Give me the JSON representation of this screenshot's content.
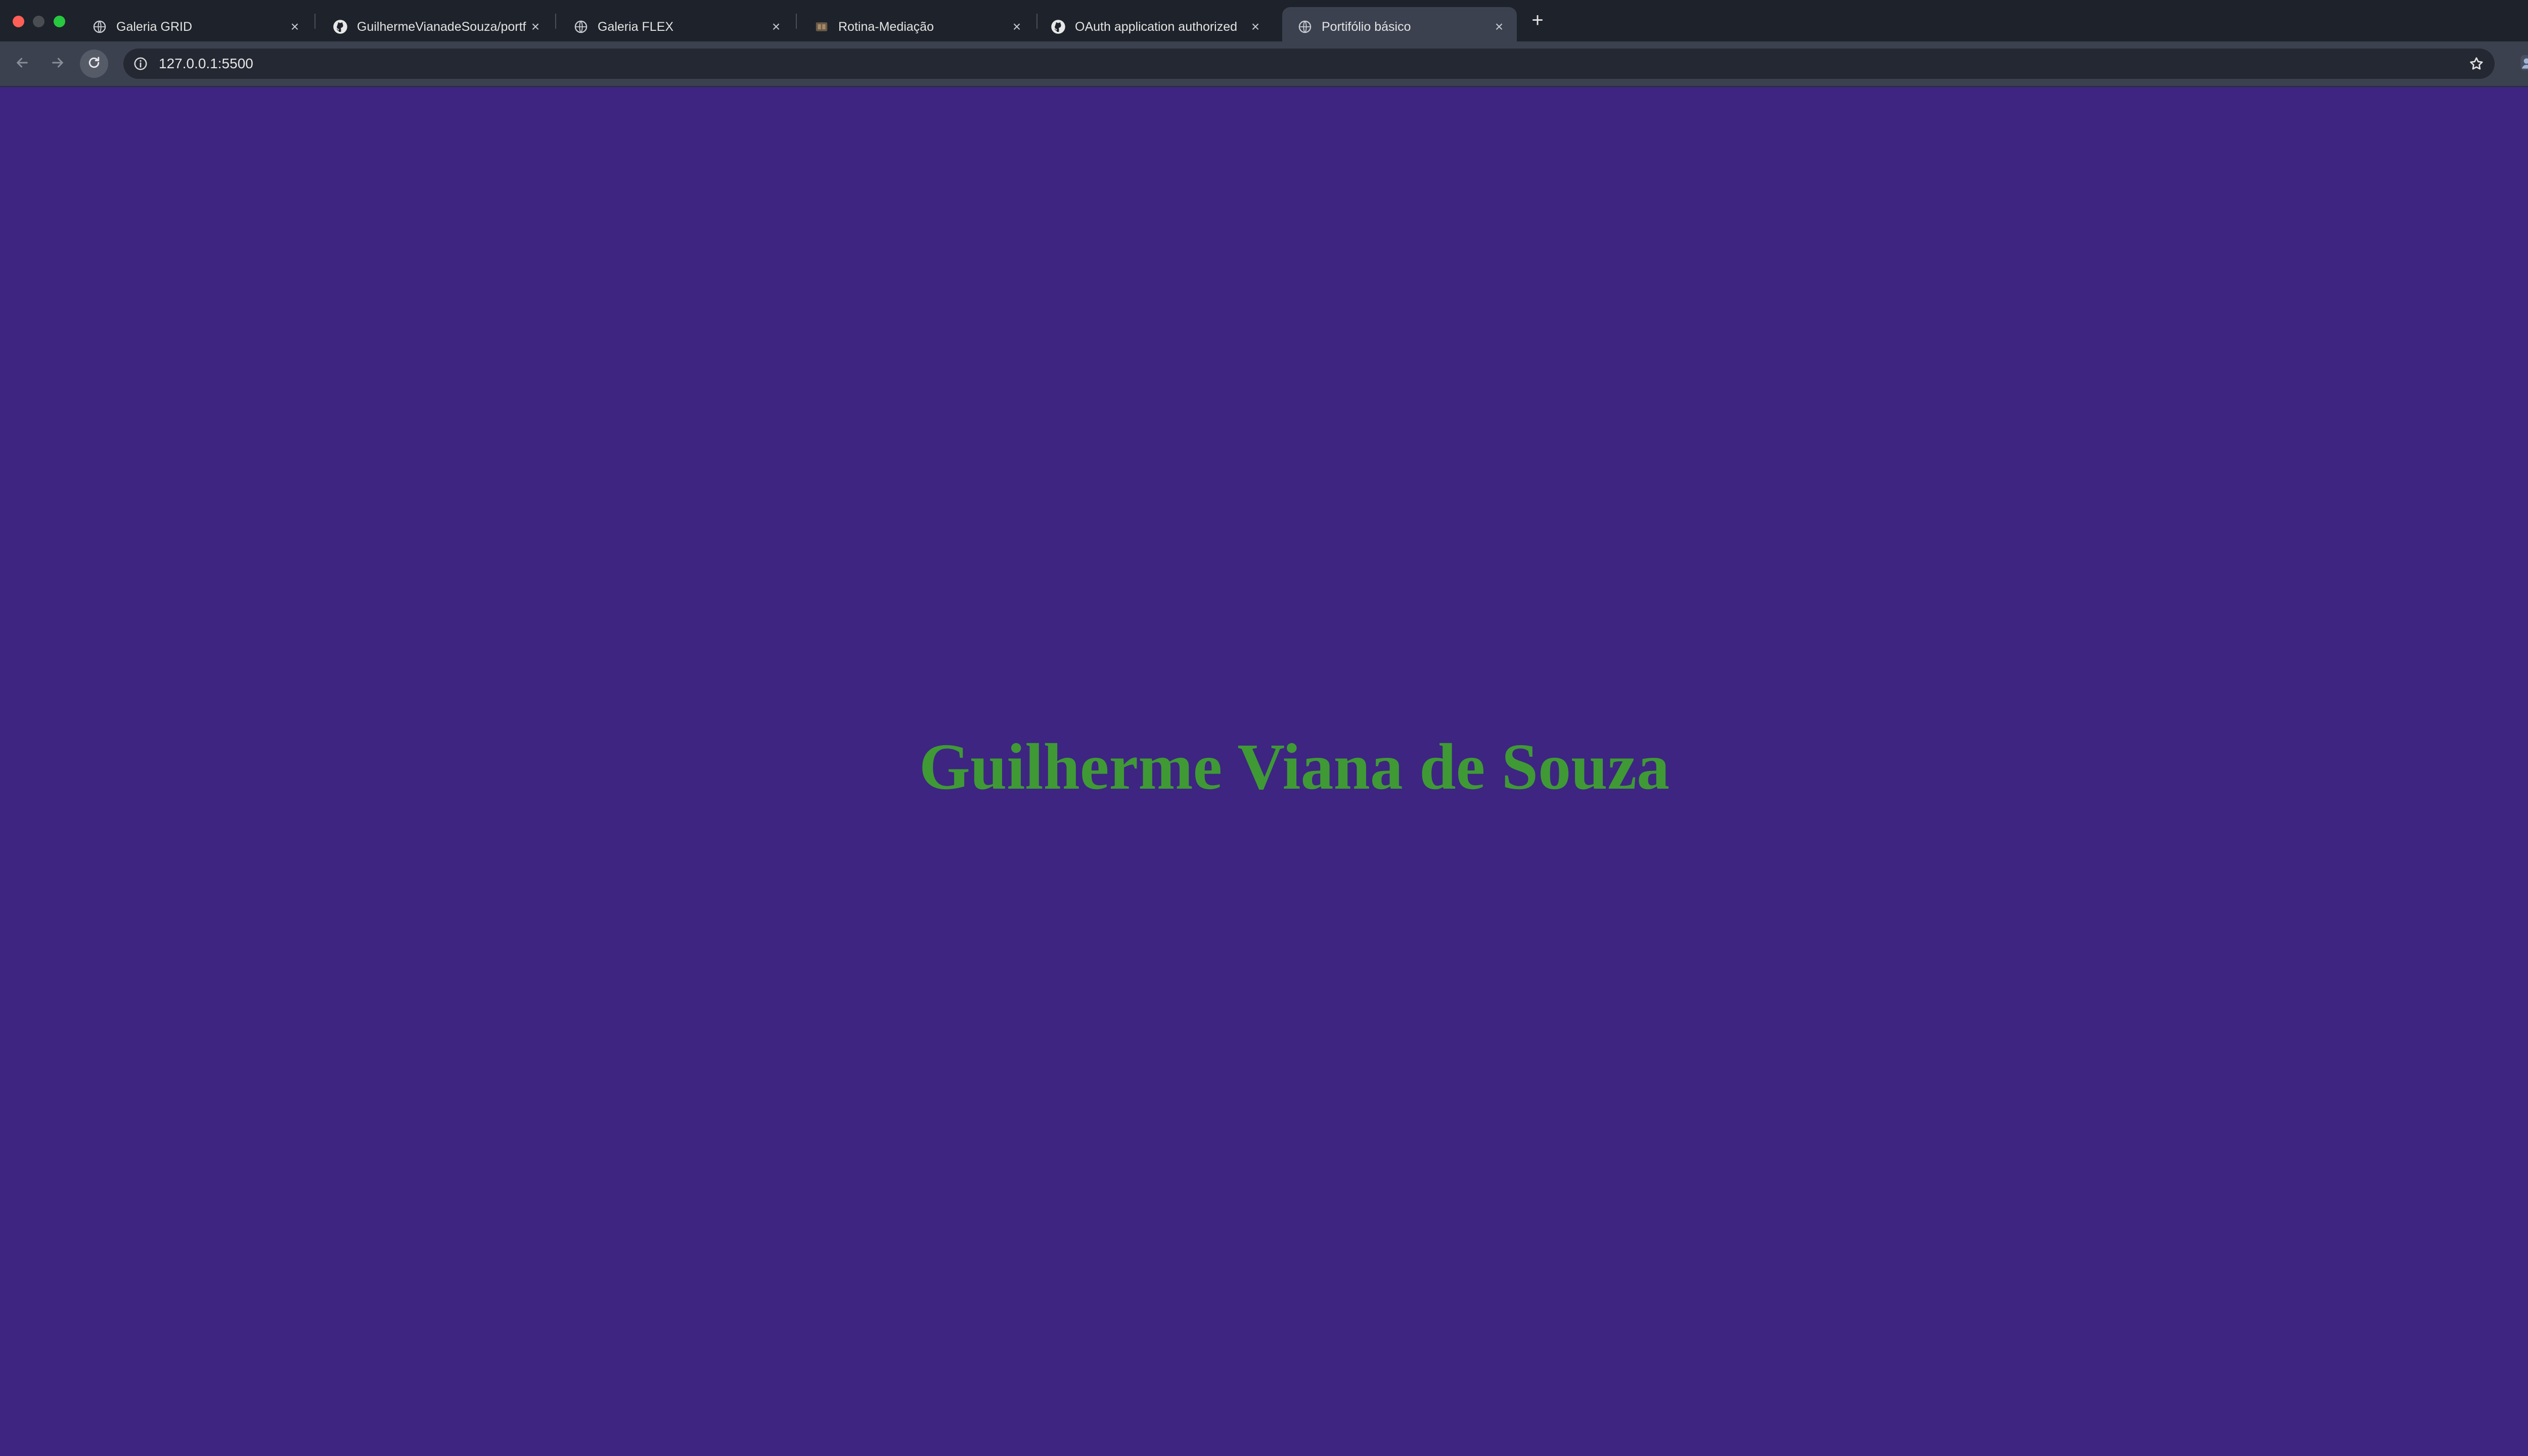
{
  "browser": {
    "tabs": [
      {
        "label": "Galeria GRID",
        "icon": "globe-icon",
        "active": false
      },
      {
        "label": "GuilhermeVianadeSouza/portf",
        "icon": "github-icon",
        "active": false
      },
      {
        "label": "Galeria FLEX",
        "icon": "globe-icon",
        "active": false
      },
      {
        "label": "Rotina-Mediação",
        "icon": "app-icon",
        "active": false
      },
      {
        "label": "OAuth application authorized",
        "icon": "github-icon",
        "active": false
      },
      {
        "label": "Portifólio básico",
        "icon": "globe-icon",
        "active": true
      }
    ],
    "new_tab_label": "+",
    "address": "127.0.0.1:5500"
  },
  "page": {
    "heading": "Guilherme Viana de Souza",
    "background_color": "#3d2581",
    "heading_color": "#3f9a35"
  }
}
